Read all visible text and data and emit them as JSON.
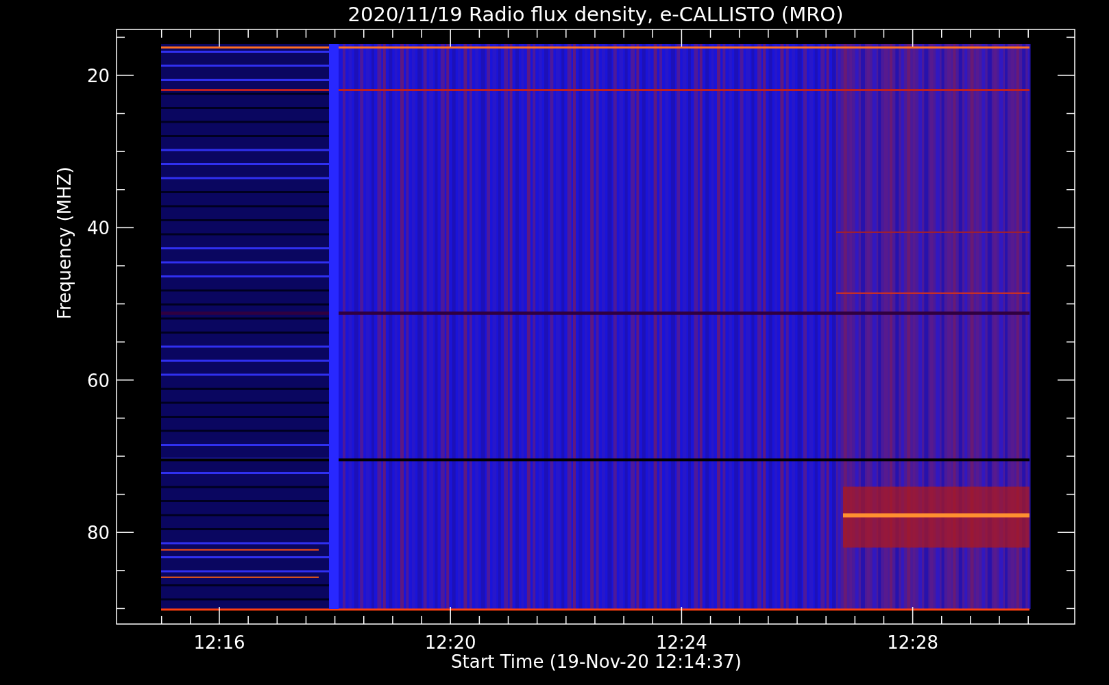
{
  "title": "2020/11/19  Radio flux density, e-CALLISTO (MRO)",
  "y_axis": {
    "label": "Frequency (MHZ)",
    "ticks": [
      "20",
      "40",
      "60",
      "80"
    ]
  },
  "x_axis": {
    "label": "Start Time (19-Nov-20 12:14:37)",
    "ticks": [
      "12:16",
      "12:20",
      "12:24",
      "12:28"
    ]
  }
}
